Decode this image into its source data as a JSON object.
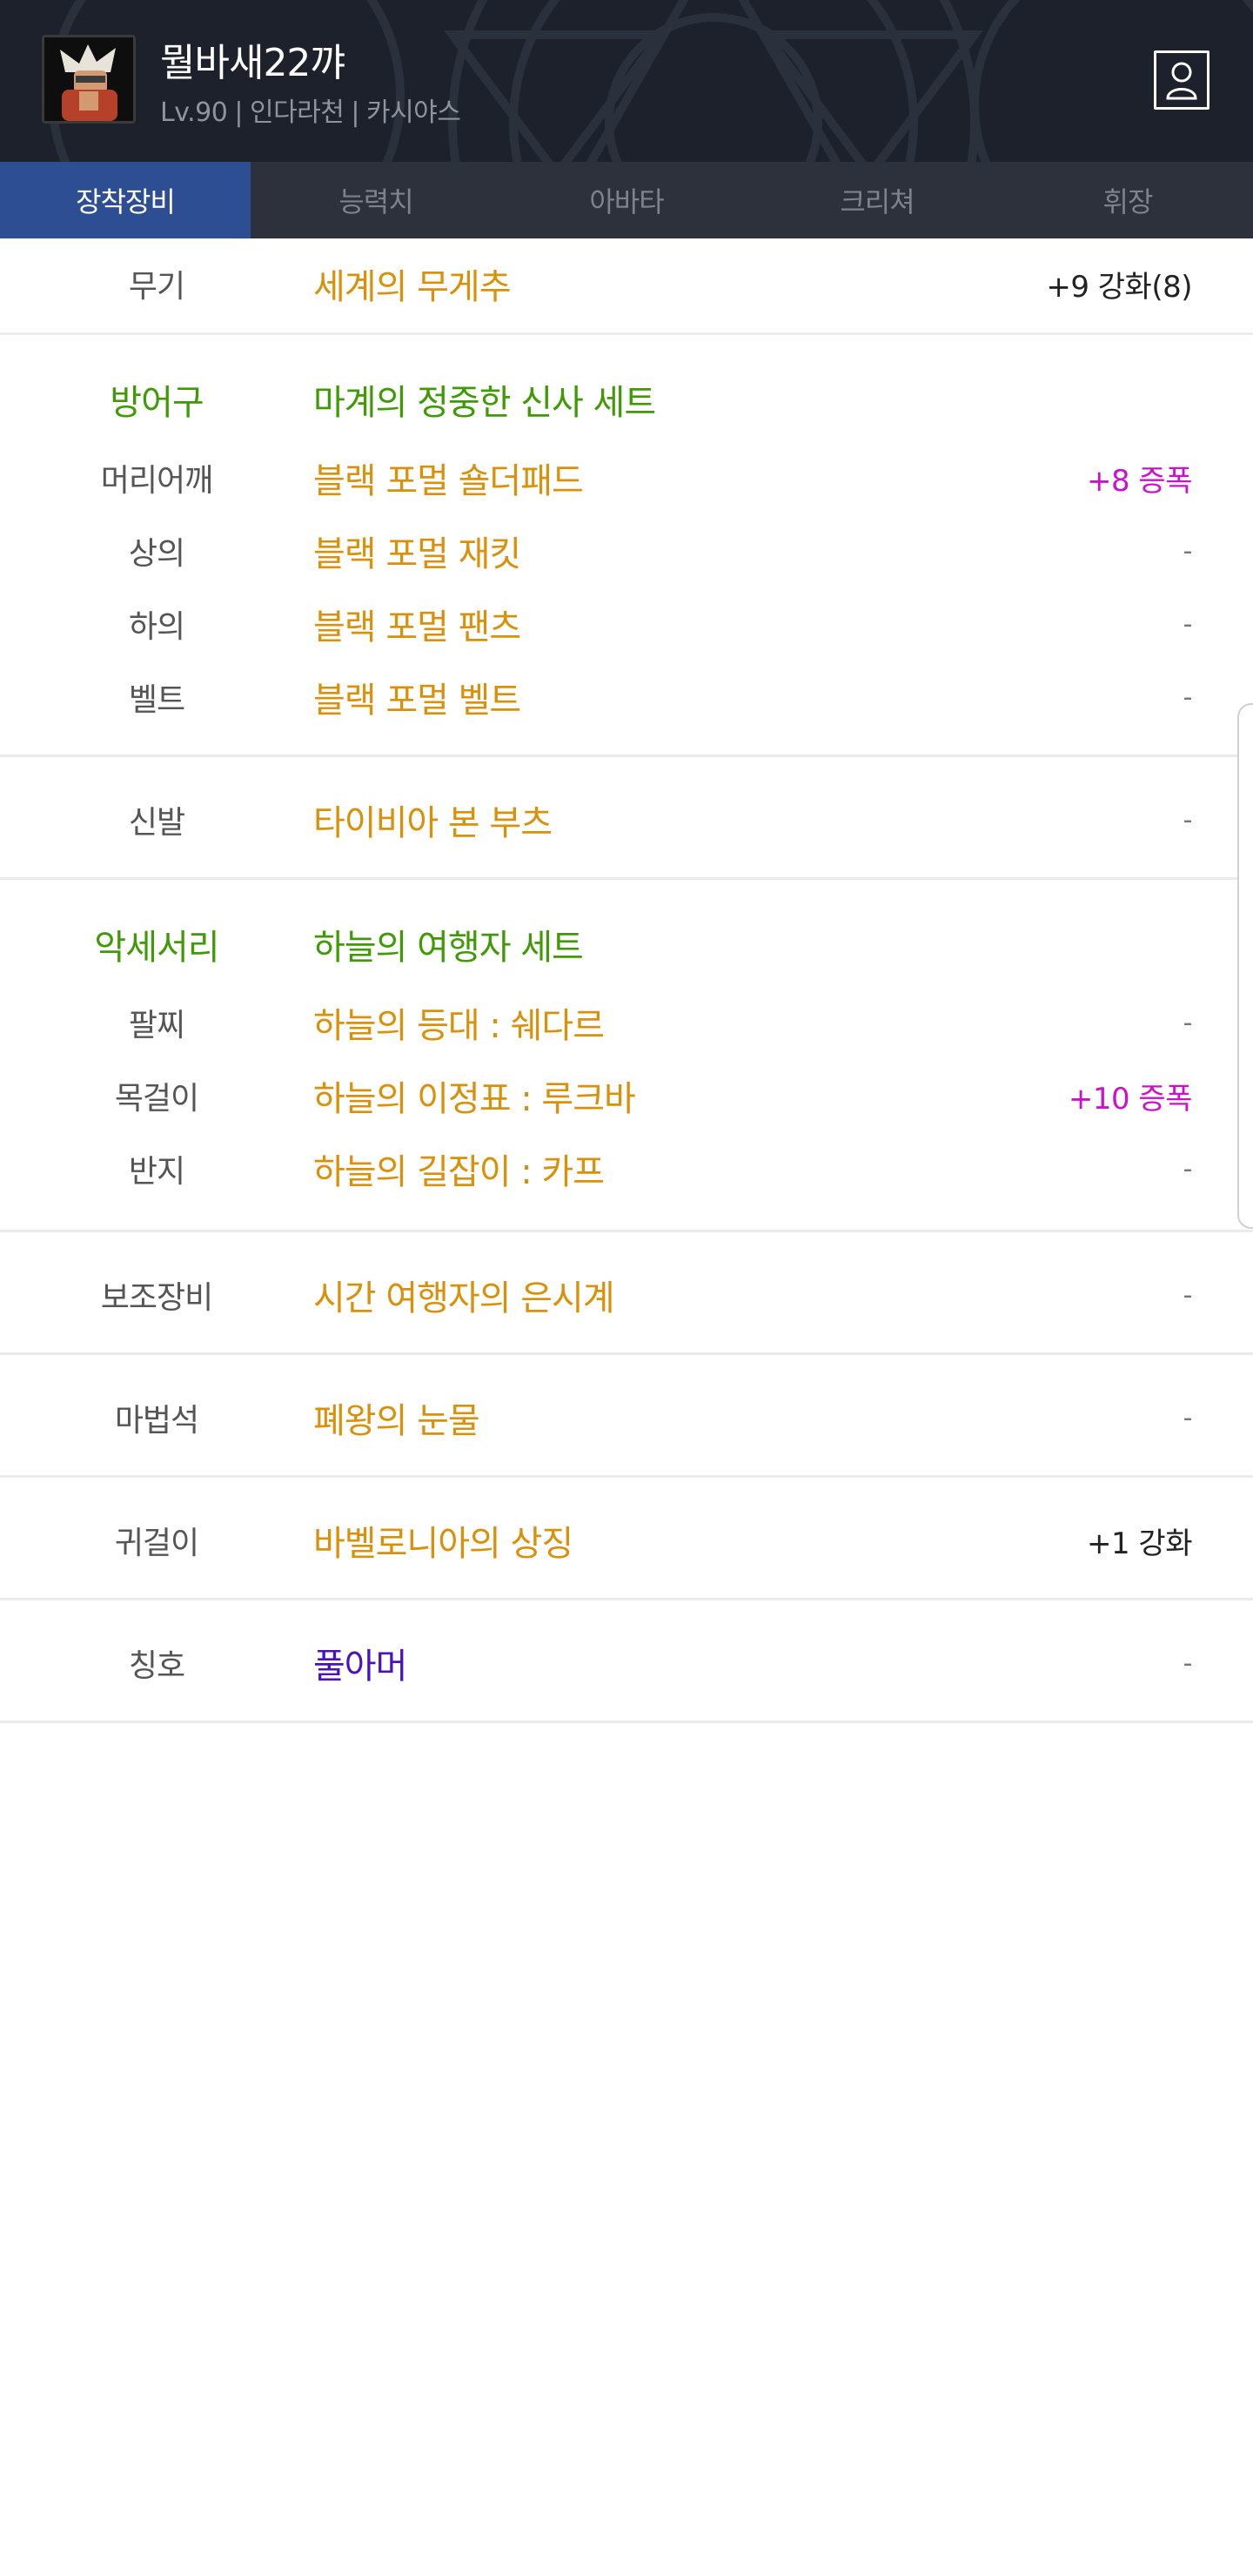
{
  "header": {
    "character_name": "뭘바새22꺄",
    "level": "Lv.90",
    "job": "인다라천",
    "server": "카시야스",
    "separator": "|",
    "profile_icon": "person-icon"
  },
  "tabs": [
    {
      "label": "장착장비",
      "active": true
    },
    {
      "label": "능력치",
      "active": false
    },
    {
      "label": "아바타",
      "active": false
    },
    {
      "label": "크리쳐",
      "active": false
    },
    {
      "label": "휘장",
      "active": false
    }
  ],
  "equipment": {
    "weapon": {
      "slot": "무기",
      "name": "세계의 무게추",
      "value": "+9 강화(8)"
    },
    "armor": {
      "slot": "방어구",
      "set_name": "마계의 정중한 신사 세트",
      "items": [
        {
          "slot": "머리어깨",
          "name": "블랙 포멀 숄더패드",
          "value": "+8 증폭"
        },
        {
          "slot": "상의",
          "name": "블랙 포멀 재킷",
          "value": "-"
        },
        {
          "slot": "하의",
          "name": "블랙 포멀 팬츠",
          "value": "-"
        },
        {
          "slot": "벨트",
          "name": "블랙 포멀 벨트",
          "value": "-"
        }
      ]
    },
    "shoes": {
      "slot": "신발",
      "name": "타이비아 본 부츠",
      "value": "-"
    },
    "accessory": {
      "slot": "악세서리",
      "set_name": "하늘의 여행자 세트",
      "items": [
        {
          "slot": "팔찌",
          "name": "하늘의 등대 : 쉐다르",
          "value": "-"
        },
        {
          "slot": "목걸이",
          "name": "하늘의 이정표 : 루크바",
          "value": "+10 증폭"
        },
        {
          "slot": "반지",
          "name": "하늘의 길잡이 : 카프",
          "value": "-"
        }
      ]
    },
    "sub_equipment": {
      "slot": "보조장비",
      "name": "시간 여행자의 은시계",
      "value": "-"
    },
    "magic_stone": {
      "slot": "마법석",
      "name": "폐왕의 눈물",
      "value": "-"
    },
    "earring": {
      "slot": "귀걸이",
      "name": "바벨로니아의 상징",
      "value": "+1 강화"
    },
    "title": {
      "slot": "칭호",
      "name": "풀아머",
      "value": "-"
    }
  },
  "colors": {
    "item_name": "#d9900a",
    "set_name": "#3f9a06",
    "amplify": "#cc11cc",
    "title_item": "#4b12b8",
    "active_tab": "#2e4e94",
    "header_bg": "#1c212b"
  }
}
